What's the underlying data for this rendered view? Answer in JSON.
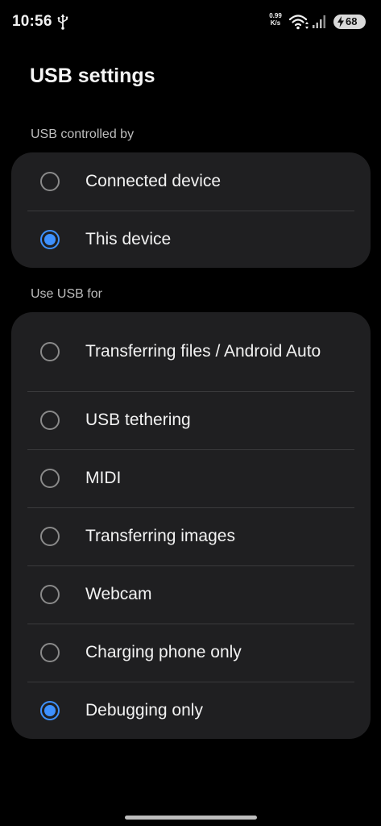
{
  "status_bar": {
    "time": "10:56",
    "usb_icon": "usb-icon",
    "net_speed_value": "0.99",
    "net_speed_unit": "K/s",
    "wifi_icon": "wifi-icon",
    "signal_icon": "signal-icon",
    "battery_level": "68",
    "battery_charging": true
  },
  "page": {
    "title": "USB settings"
  },
  "controlled_by": {
    "label": "USB controlled by",
    "options": [
      {
        "label": "Connected device",
        "selected": false
      },
      {
        "label": "This device",
        "selected": true
      }
    ]
  },
  "use_usb_for": {
    "label": "Use USB for",
    "options": [
      {
        "label": "Transferring files / Android Auto",
        "selected": false
      },
      {
        "label": "USB tethering",
        "selected": false
      },
      {
        "label": "MIDI",
        "selected": false
      },
      {
        "label": "Transferring images",
        "selected": false
      },
      {
        "label": "Webcam",
        "selected": false
      },
      {
        "label": "Charging phone only",
        "selected": false
      },
      {
        "label": "Debugging only",
        "selected": true
      }
    ]
  },
  "colors": {
    "background": "#000000",
    "card": "#1f1f21",
    "accent": "#3e91ff",
    "divider": "#3a3a3c"
  }
}
